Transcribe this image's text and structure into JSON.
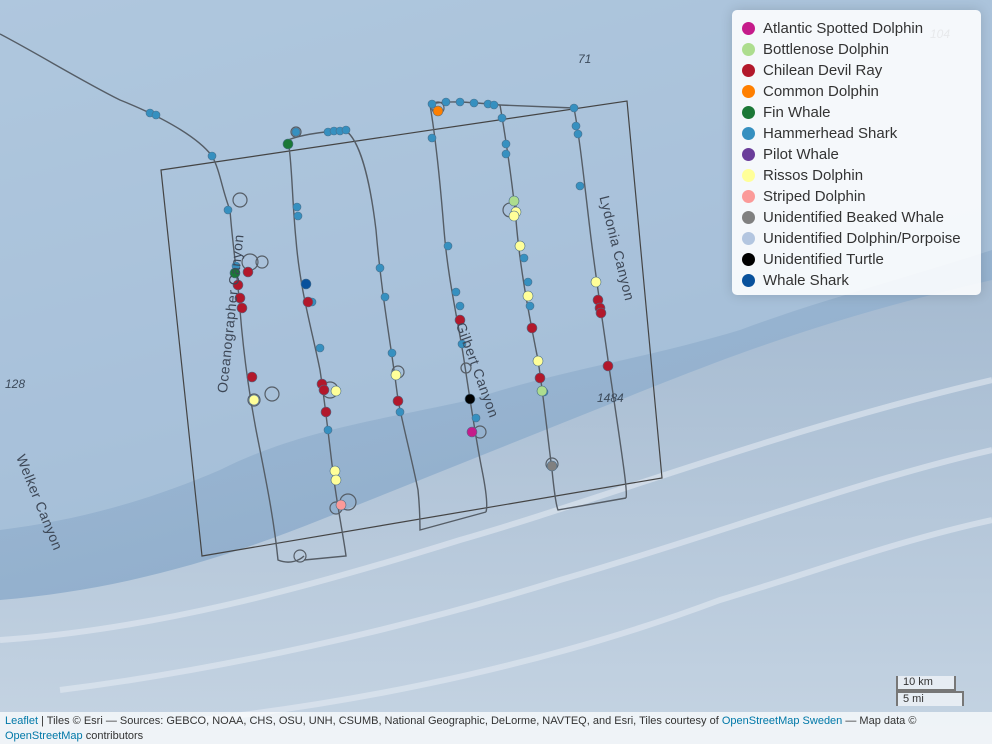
{
  "legend": {
    "items": [
      {
        "label": "Atlantic Spotted Dolphin",
        "color": "#c51b8a"
      },
      {
        "label": "Bottlenose Dolphin",
        "color": "#addd8e"
      },
      {
        "label": "Chilean Devil Ray",
        "color": "#b2182b"
      },
      {
        "label": "Common Dolphin",
        "color": "#ff7f00"
      },
      {
        "label": "Fin Whale",
        "color": "#1b7837"
      },
      {
        "label": "Hammerhead Shark",
        "color": "#3690c0"
      },
      {
        "label": "Pilot Whale",
        "color": "#6a3d9a"
      },
      {
        "label": "Rissos Dolphin",
        "color": "#ffff99"
      },
      {
        "label": "Striped Dolphin",
        "color": "#fb9a99"
      },
      {
        "label": "Unidentified Beaked Whale",
        "color": "#808080"
      },
      {
        "label": "Unidentified Dolphin/Porpoise",
        "color": "#b3c6e0"
      },
      {
        "label": "Unidentified Turtle",
        "color": "#000000"
      },
      {
        "label": "Whale Shark",
        "color": "#08519c"
      }
    ]
  },
  "map_labels": {
    "depth_71": "71",
    "depth_104": "104",
    "depth_128": "128",
    "depth_1484": "1484",
    "canyon_oceanographer": "Oceanographer Canyon",
    "canyon_gilbert": "Gilbert Canyon",
    "canyon_lydonia": "Lydonia Canyon",
    "canyon_welker": "Welker Canyon"
  },
  "scale": {
    "km": "10 km",
    "mi": "5 mi"
  },
  "attribution": {
    "leaflet": "Leaflet",
    "text1": " | Tiles © Esri — Sources: GEBCO, NOAA, CHS, OSU, UNH, CSUMB, National Geographic, DeLorme, NAVTEQ, and Esri, Tiles courtesy of ",
    "osm_sweden": "OpenStreetMap Sweden",
    "text2": " — Map data © ",
    "osm": "OpenStreetMap",
    "text3": " contributors"
  }
}
